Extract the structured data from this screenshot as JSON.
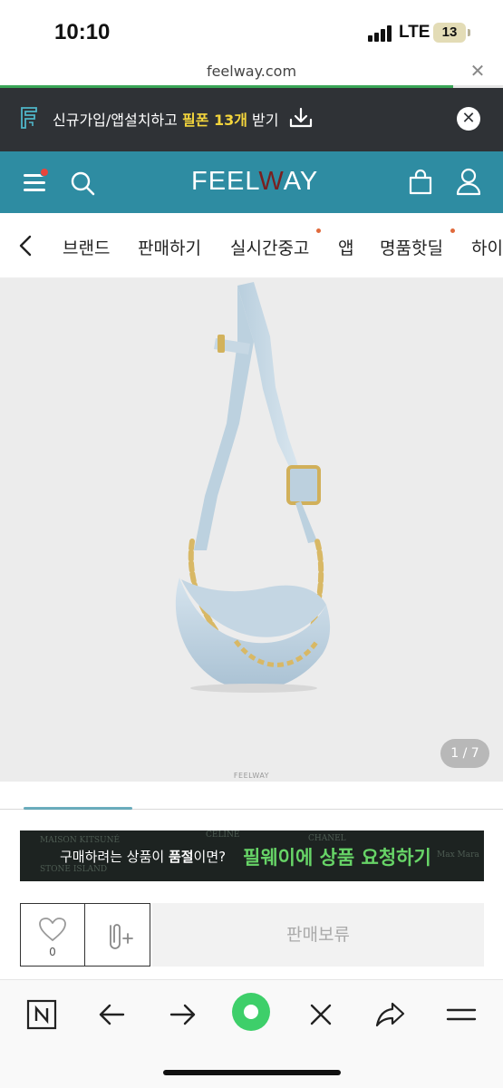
{
  "status_bar": {
    "time": "10:10",
    "network": "LTE",
    "battery": "13"
  },
  "browser": {
    "url": "feelway.com",
    "close_symbol": "✕",
    "load_progress": 0.9
  },
  "promo": {
    "text_before": "신규가입/앱설치하고 ",
    "highlight": "필폰 13개",
    "text_after": " 받기",
    "close_symbol": "✕"
  },
  "header": {
    "logo_prefix": "FEEL",
    "logo_w": "W",
    "logo_suffix": "AY"
  },
  "nav": {
    "items": [
      "브랜드",
      "판매하기",
      "실시간중고",
      "앱",
      "명품핫딜",
      "하이"
    ]
  },
  "product": {
    "watermark": "FEELWAY",
    "counter": "1 / 7"
  },
  "ad": {
    "question_before": "구매하려는 상품이 ",
    "question_bold": "품절",
    "question_after": "이면?",
    "cta": "필웨이에 상품 요청하기",
    "bg_words": [
      "MAISON KITSUNÉ",
      "CHANEL",
      "STONE ISLAND",
      "CELINE",
      "Max Mara"
    ]
  },
  "actions": {
    "like_count": "0",
    "status_label": "판매보류"
  },
  "colors": {
    "brand_teal": "#2e8ca2",
    "promo_bg": "#2f3236",
    "cta_green": "#67d467",
    "highlight_yellow": "#f4d53c"
  }
}
